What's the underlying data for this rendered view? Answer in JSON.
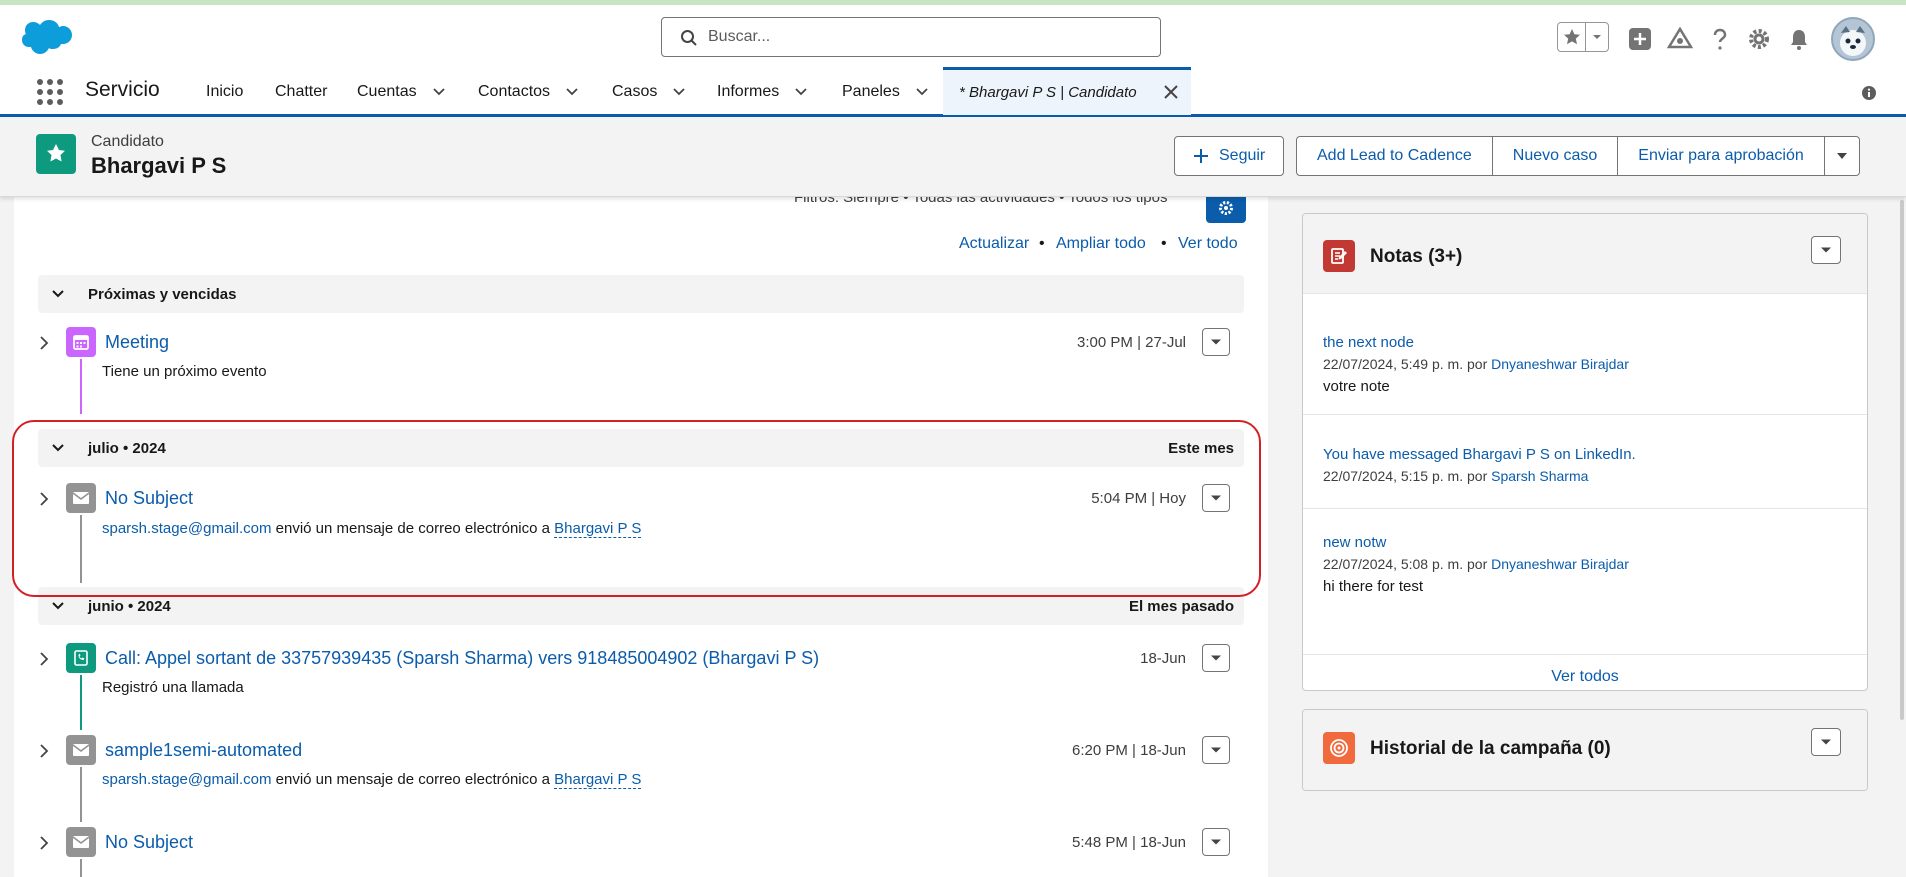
{
  "search": {
    "placeholder": "Buscar..."
  },
  "nav": {
    "app_name": "Servicio",
    "items": [
      "Inicio",
      "Chatter",
      "Cuentas",
      "Contactos",
      "Casos",
      "Informes",
      "Paneles"
    ],
    "active_tab": "* Bhargavi P S | Candidato"
  },
  "record": {
    "type": "Candidato",
    "name": "Bhargavi P S",
    "buttons": [
      "Seguir",
      "Add Lead to Cadence",
      "Nuevo caso",
      "Enviar para aprobación"
    ]
  },
  "activity": {
    "filters": "Filtros: Siempre • Todas las actividades • Todos los tipos",
    "links": [
      "Actualizar",
      "Ampliar todo",
      "Ver todo"
    ],
    "sections": [
      {
        "title": "Próximas y vencidas",
        "right": "",
        "items": [
          {
            "title": "Meeting",
            "time": "3:00 PM | 27-Jul",
            "sub": "Tiene un próximo evento"
          }
        ]
      },
      {
        "title": "julio • 2024",
        "right": "Este mes",
        "items": [
          {
            "title": "No Subject",
            "time": "5:04 PM | Hoy",
            "sender": "sparsh.stage@gmail.com",
            "sub": "envió un mensaje de correo electrónico a",
            "recipient": "Bhargavi P S"
          }
        ]
      },
      {
        "title": "junio • 2024",
        "right": "El mes pasado",
        "items": [
          {
            "title": "Call: Appel sortant de 33757939435 (Sparsh Sharma) vers 918485004902 (Bhargavi P S)",
            "time": "18-Jun",
            "sub": "Registró una llamada"
          },
          {
            "title": "sample1semi-automated",
            "time": "6:20 PM | 18-Jun",
            "sender": "sparsh.stage@gmail.com",
            "sub": "envió un mensaje de correo electrónico a",
            "recipient": "Bhargavi P S"
          },
          {
            "title": "No Subject",
            "time": "5:48 PM | 18-Jun"
          }
        ]
      }
    ]
  },
  "notes": {
    "title": "Notas (3+)",
    "items": [
      {
        "title": "the next node",
        "meta": "22/07/2024, 5:49 p. m. por",
        "author": "Dnyaneshwar Birajdar",
        "body": "votre note"
      },
      {
        "title": "You have messaged Bhargavi P S on LinkedIn.",
        "meta": "22/07/2024, 5:15 p. m. por",
        "author": "Sparsh Sharma",
        "body": ""
      },
      {
        "title": "new notw",
        "meta": "22/07/2024, 5:08 p. m. por",
        "author": "Dnyaneshwar Birajdar",
        "body": "hi there for test"
      }
    ],
    "view_all": "Ver todos"
  },
  "campaign": {
    "title": "Historial de la campaña (0)"
  },
  "colors": {
    "brand": "#0b5cab",
    "event": "#cb65ff",
    "email": "#939393",
    "call": "#0e9a7e",
    "notes": "#c23934",
    "campaign": "#f06a3d",
    "highlight": "#d51f26"
  }
}
